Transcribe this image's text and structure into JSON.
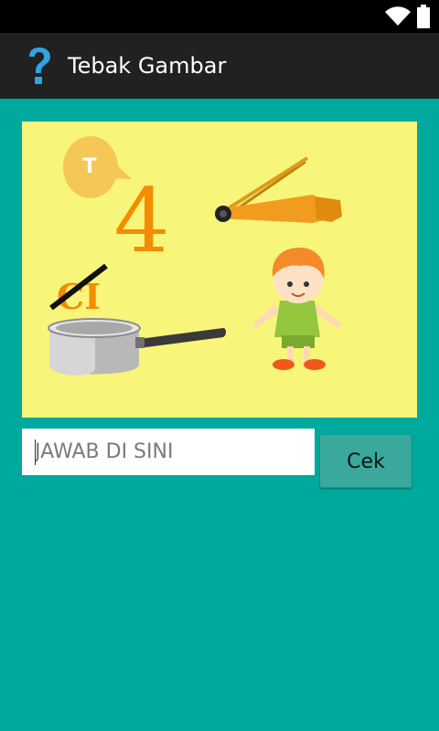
{
  "status_bar": {
    "icons": [
      "wifi-icon",
      "battery-icon"
    ]
  },
  "action_bar": {
    "title": "Tebak Gambar",
    "icon": "question-mark-icon",
    "icon_color": "#2FA3E3"
  },
  "puzzle": {
    "bubble_letter": "T",
    "number": "4",
    "crossed_syllable": "CI",
    "accent_color": "#F28C00",
    "background_color": "#F8F57B"
  },
  "answer": {
    "placeholder": "JAWAB DI SINI",
    "value": ""
  },
  "check_button": {
    "label": "Cek"
  },
  "colors": {
    "screen_bg": "#00A99D",
    "actionbar_bg": "#212121",
    "button_bg": "#3AA89C"
  }
}
